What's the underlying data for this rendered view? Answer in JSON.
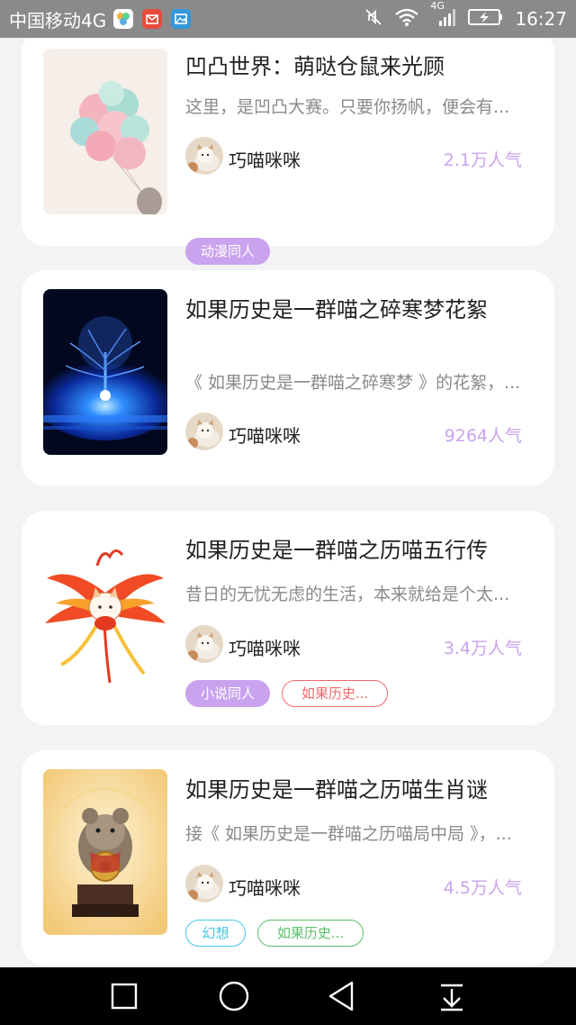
{
  "status_bar": {
    "carrier": "中国移动4G",
    "network_badge": "4G",
    "time": "16:27",
    "icons": [
      "photos-app-icon",
      "mail-app-icon",
      "gallery-app-icon",
      "mute-icon",
      "wifi-icon",
      "signal-icon",
      "battery-charging-icon"
    ]
  },
  "colors": {
    "accent": "#c9a3ee",
    "tag_red": "#ef6b6b",
    "tag_cyan": "#43c5e4",
    "tag_green": "#5cbf6a"
  },
  "cards": [
    {
      "title": "凹凸世界：萌哒仓鼠来光顾",
      "description": "这里，是凹凸大赛。只要你扬帆，便会有...",
      "author": "巧喵咪咪",
      "popularity": "2.1万人气",
      "tags": [
        {
          "label": "动漫同人",
          "style": "filled"
        }
      ],
      "cover": "balloons-cover"
    },
    {
      "title": "如果历史是一群喵之碎寒梦花絮",
      "description": "《 如果历史是一群喵之碎寒梦 》的花絮，...",
      "author": "巧喵咪咪",
      "popularity": "9264人气",
      "tags": [],
      "cover": "glowing-tree-cover"
    },
    {
      "title": "如果历史是一群喵之历喵五行传",
      "description": "昔日的无忧无虑的生活，本来就给是个太...",
      "author": "巧喵咪咪",
      "popularity": "3.4万人气",
      "tags": [
        {
          "label": "小说同人",
          "style": "filled"
        },
        {
          "label": "如果历史...",
          "style": "outline-red"
        }
      ],
      "cover": "phoenix-cat-cover"
    },
    {
      "title": "如果历史是一群喵之历喵生肖谜",
      "description": "接《 如果历史是一群喵之历喵局中局 》，...",
      "author": "巧喵咪咪",
      "popularity": "4.5万人气",
      "tags": [
        {
          "label": "幻想",
          "style": "outline-cyan"
        },
        {
          "label": "如果历史...",
          "style": "outline-green"
        }
      ],
      "cover": "hamster-statue-cover"
    }
  ],
  "nav_bar": {
    "buttons": [
      "recent-apps-button",
      "home-button",
      "back-button",
      "notification-pull-button"
    ]
  }
}
